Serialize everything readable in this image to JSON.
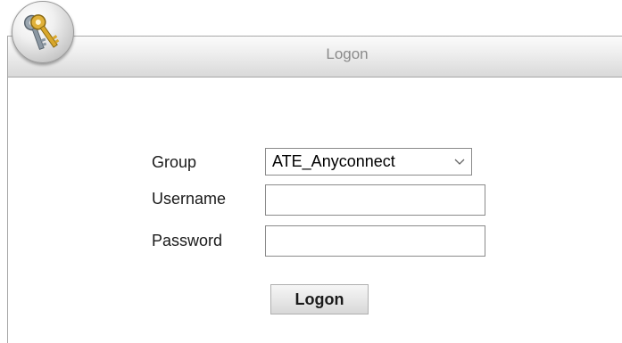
{
  "window": {
    "title": "Logon"
  },
  "form": {
    "group_label": "Group",
    "group_value": "ATE_Anyconnect",
    "username_label": "Username",
    "username_value": "",
    "password_label": "Password",
    "password_value": "",
    "submit_label": "Logon"
  },
  "icons": {
    "logo": "keys-icon",
    "dropdown": "chevron-down-icon"
  }
}
